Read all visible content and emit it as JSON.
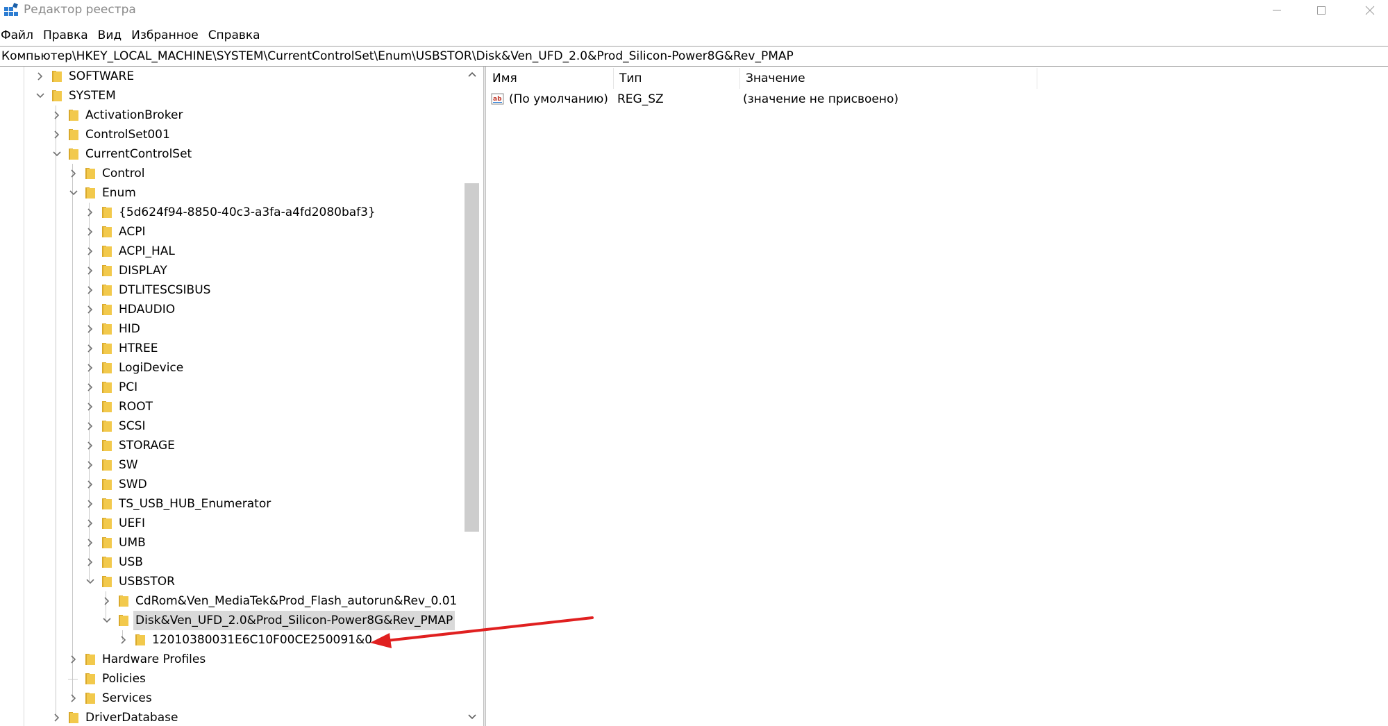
{
  "window": {
    "title": "Редактор реестра",
    "icon": "registry-editor-icon",
    "controls": [
      "minimize-icon",
      "maximize-icon",
      "close-icon"
    ]
  },
  "menu": {
    "file": "Файл",
    "edit": "Правка",
    "view": "Вид",
    "favorites": "Избранное",
    "help": "Справка"
  },
  "address": {
    "path": "Компьютер\\HKEY_LOCAL_MACHINE\\SYSTEM\\CurrentControlSet\\Enum\\USBSTOR\\Disk&Ven_UFD_2.0&Prod_Silicon-Power8G&Rev_PMAP"
  },
  "tree": {
    "items": [
      {
        "label": "SOFTWARE",
        "depth": 0,
        "state": "collapsed"
      },
      {
        "label": "SYSTEM",
        "depth": 0,
        "state": "expanded"
      },
      {
        "label": "ActivationBroker",
        "depth": 1,
        "state": "collapsed"
      },
      {
        "label": "ControlSet001",
        "depth": 1,
        "state": "collapsed"
      },
      {
        "label": "CurrentControlSet",
        "depth": 1,
        "state": "expanded"
      },
      {
        "label": "Control",
        "depth": 2,
        "state": "collapsed"
      },
      {
        "label": "Enum",
        "depth": 2,
        "state": "expanded"
      },
      {
        "label": "{5d624f94-8850-40c3-a3fa-a4fd2080baf3}",
        "depth": 3,
        "state": "collapsed"
      },
      {
        "label": "ACPI",
        "depth": 3,
        "state": "collapsed"
      },
      {
        "label": "ACPI_HAL",
        "depth": 3,
        "state": "collapsed"
      },
      {
        "label": "DISPLAY",
        "depth": 3,
        "state": "collapsed"
      },
      {
        "label": "DTLITESCSIBUS",
        "depth": 3,
        "state": "collapsed"
      },
      {
        "label": "HDAUDIO",
        "depth": 3,
        "state": "collapsed"
      },
      {
        "label": "HID",
        "depth": 3,
        "state": "collapsed"
      },
      {
        "label": "HTREE",
        "depth": 3,
        "state": "collapsed"
      },
      {
        "label": "LogiDevice",
        "depth": 3,
        "state": "collapsed"
      },
      {
        "label": "PCI",
        "depth": 3,
        "state": "collapsed"
      },
      {
        "label": "ROOT",
        "depth": 3,
        "state": "collapsed"
      },
      {
        "label": "SCSI",
        "depth": 3,
        "state": "collapsed"
      },
      {
        "label": "STORAGE",
        "depth": 3,
        "state": "collapsed"
      },
      {
        "label": "SW",
        "depth": 3,
        "state": "collapsed"
      },
      {
        "label": "SWD",
        "depth": 3,
        "state": "collapsed"
      },
      {
        "label": "TS_USB_HUB_Enumerator",
        "depth": 3,
        "state": "collapsed"
      },
      {
        "label": "UEFI",
        "depth": 3,
        "state": "collapsed"
      },
      {
        "label": "UMB",
        "depth": 3,
        "state": "collapsed"
      },
      {
        "label": "USB",
        "depth": 3,
        "state": "collapsed"
      },
      {
        "label": "USBSTOR",
        "depth": 3,
        "state": "expanded"
      },
      {
        "label": "CdRom&Ven_MediaTek&Prod_Flash_autorun&Rev_0.01",
        "depth": 4,
        "state": "collapsed"
      },
      {
        "label": "Disk&Ven_UFD_2.0&Prod_Silicon-Power8G&Rev_PMAP",
        "depth": 4,
        "state": "expanded",
        "selected": true
      },
      {
        "label": "12010380031E6C10F00CE250091&0",
        "depth": 5,
        "state": "collapsed"
      },
      {
        "label": "Hardware Profiles",
        "depth": 2,
        "state": "collapsed"
      },
      {
        "label": "Policies",
        "depth": 2,
        "state": "leaf"
      },
      {
        "label": "Services",
        "depth": 2,
        "state": "collapsed"
      },
      {
        "label": "DriverDatabase",
        "depth": 1,
        "state": "collapsed"
      }
    ]
  },
  "list": {
    "columns": {
      "name": "Имя",
      "type": "Тип",
      "data": "Значение"
    },
    "rows": [
      {
        "icon": "string-value-icon",
        "name": "(По умолчанию)",
        "type": "REG_SZ",
        "data": "(значение не присвоено)"
      }
    ]
  },
  "annotation": {
    "color": "#e02020",
    "icon": "red-arrow-icon"
  },
  "colors": {
    "selection": "#d9d9d9",
    "folder": "#f2c94c",
    "folder_dark": "#d9a92b"
  }
}
